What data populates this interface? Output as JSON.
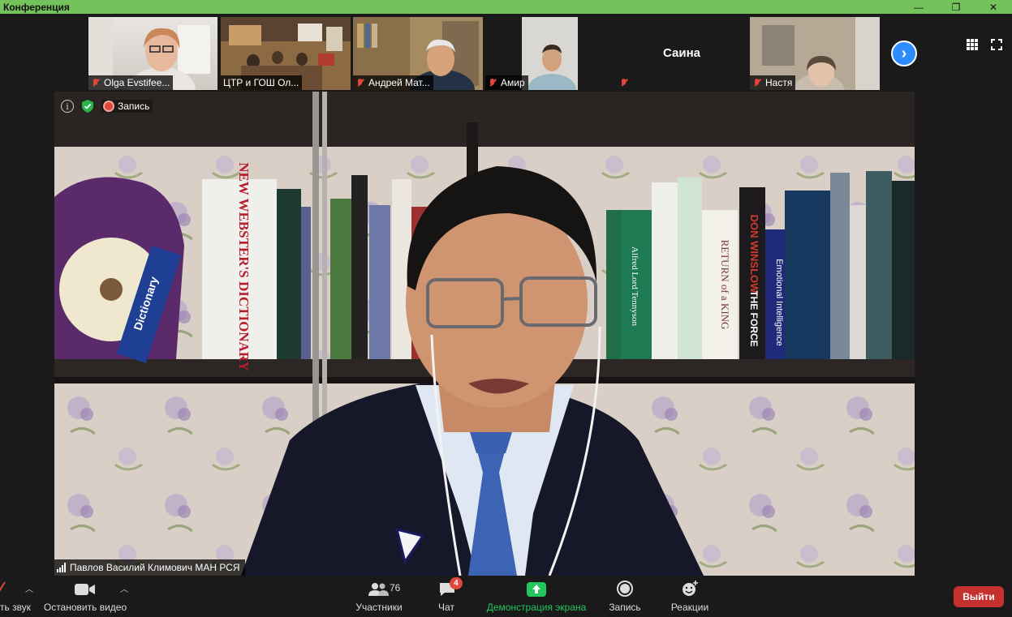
{
  "window": {
    "title": "Конференция",
    "buttons": [
      "—",
      "❐",
      "✕"
    ]
  },
  "gallery": {
    "participants": [
      {
        "name": "Olga Evstifee...",
        "muted": true
      },
      {
        "name": "ЦТР и ГОШ Ол...",
        "muted": true
      },
      {
        "name": "Андрей Мат...",
        "muted": true
      },
      {
        "name": "Амир",
        "muted": true
      },
      {
        "name": "Саина",
        "muted": true,
        "video": false
      },
      {
        "name": "Настя",
        "muted": true
      }
    ],
    "next_icon": "›"
  },
  "main": {
    "recording_label": "Запись",
    "info_icon": "i",
    "speaker_name": "Павлов Василий Климович МАН РСЯ"
  },
  "books": [
    {
      "text": "NEW WEBSTER'S DICTIONARY"
    },
    {
      "text": "Dictionary"
    },
    {
      "text": "DON WINSLOW"
    },
    {
      "text": "THE FORCE"
    },
    {
      "text": "RETURN of a KING"
    },
    {
      "text": "Emotional Intelligence"
    },
    {
      "text": "Alfred Lord Tennyson"
    }
  ],
  "toolbar": {
    "audio_label": "ть звук",
    "video_label": "Остановить видео",
    "participants_label": "Участники",
    "participants_count": "76",
    "chat_label": "Чат",
    "chat_badge": "4",
    "share_label": "Демонстрация экрана",
    "record_label": "Запись",
    "reactions_label": "Реакции",
    "leave_label": "Выйти"
  },
  "colors": {
    "titlebar": "#74c25c",
    "share_green": "#22c55e",
    "leave_red": "#c4312f",
    "accent_blue": "#2d8cff"
  }
}
